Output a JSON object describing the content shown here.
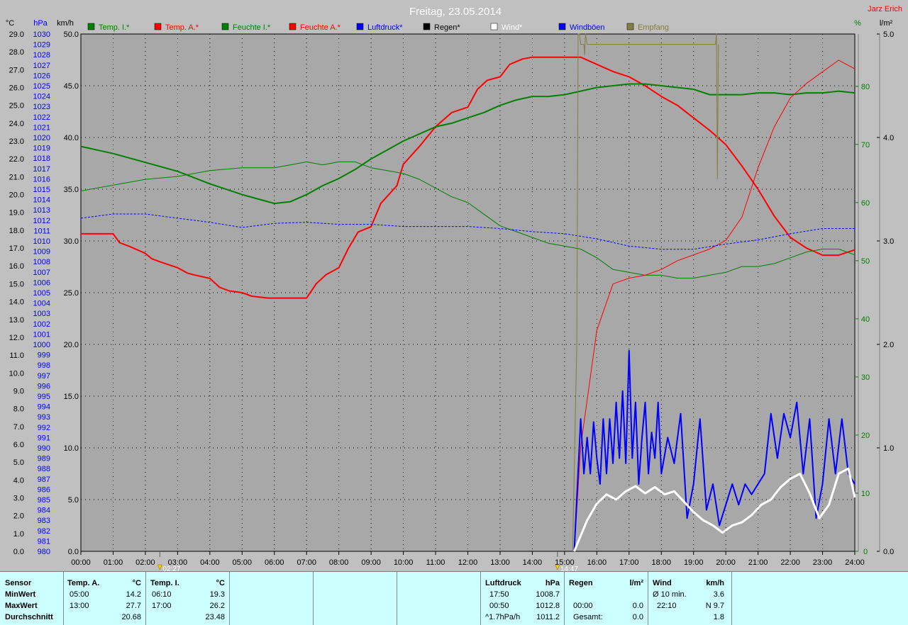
{
  "title": "Freitag, 23.05.2014",
  "author": "Jarz Erich",
  "axis_units": {
    "temp": "°C",
    "pressure": "hPa",
    "wind": "km/h",
    "humidity": "%",
    "rain": "l/m²"
  },
  "legend": [
    {
      "name": "Temp. I.*",
      "color": "#008000"
    },
    {
      "name": "Temp. A.*",
      "color": "#ff0000"
    },
    {
      "name": "Feuchte I.*",
      "color": "#008000"
    },
    {
      "name": "Feuchte A.*",
      "color": "#ff0000"
    },
    {
      "name": "Luftdruck*",
      "color": "#0000ff"
    },
    {
      "name": "Regen*",
      "color": "#000000"
    },
    {
      "name": "Wind*",
      "color": "#ffffff"
    },
    {
      "name": "Windböen",
      "color": "#0000ff"
    },
    {
      "name": "Empfang",
      "color": "#808040"
    }
  ],
  "markers": [
    {
      "label": "02:27",
      "hour": 2.45,
      "color": "#ffd000"
    },
    {
      "label": "14:47",
      "hour": 14.78,
      "color": "#ffd000"
    }
  ],
  "chart_data": {
    "type": "line",
    "x_unit": "hour of day",
    "xlim": [
      0,
      24
    ],
    "x_tick_labels": [
      "00:00",
      "01:00",
      "02:00",
      "03:00",
      "04:00",
      "05:00",
      "06:00",
      "07:00",
      "08:00",
      "09:00",
      "10:00",
      "11:00",
      "12:00",
      "13:00",
      "14:00",
      "15:00",
      "16:00",
      "17:00",
      "18:00",
      "19:00",
      "20:00",
      "21:00",
      "22:00",
      "23:00",
      "24:00"
    ],
    "axes": {
      "temp": {
        "label": "°C",
        "range": [
          0,
          29
        ],
        "step": 1
      },
      "pressure": {
        "label": "hPa",
        "range": [
          980,
          1030
        ],
        "step": 1
      },
      "wind": {
        "label": "km/h",
        "range": [
          0,
          50
        ],
        "step": 5
      },
      "humidity": {
        "label": "%",
        "range": [
          0,
          89
        ],
        "ticks": [
          0,
          10,
          20,
          30,
          40,
          50,
          60,
          70,
          80
        ]
      },
      "rain": {
        "label": "l/m²",
        "range": [
          0,
          5
        ],
        "ticks": [
          0,
          1,
          2,
          3,
          4,
          5
        ]
      }
    },
    "series": [
      {
        "name": "Temp. A.*",
        "axis": "temp",
        "color": "#ff0000",
        "width": 2,
        "x": [
          0,
          1,
          1.2,
          1.5,
          2,
          2.2,
          2.5,
          3,
          3.3,
          3.5,
          4,
          4.3,
          4.6,
          5,
          5.3,
          5.8,
          6,
          6.5,
          7,
          7.3,
          7.6,
          8,
          8.3,
          8.6,
          9,
          9.3,
          9.8,
          10,
          10.5,
          11,
          11.5,
          12,
          12.3,
          12.6,
          13,
          13.3,
          13.7,
          14,
          14.5,
          15,
          15.5,
          16,
          16.5,
          17,
          17.5,
          18,
          18.5,
          19,
          19.5,
          20,
          20.5,
          21,
          21.5,
          22,
          22.5,
          23,
          23.5,
          24
        ],
        "y": [
          17.8,
          17.8,
          17.3,
          17.1,
          16.7,
          16.4,
          16.2,
          15.9,
          15.6,
          15.5,
          15.3,
          14.8,
          14.6,
          14.5,
          14.3,
          14.2,
          14.2,
          14.2,
          14.2,
          15.0,
          15.5,
          15.9,
          17.0,
          17.9,
          18.2,
          19.5,
          20.5,
          21.7,
          22.7,
          23.8,
          24.6,
          24.9,
          25.9,
          26.4,
          26.6,
          27.3,
          27.6,
          27.7,
          27.7,
          27.7,
          27.7,
          27.3,
          26.9,
          26.6,
          26.1,
          25.5,
          25.0,
          24.3,
          23.6,
          22.8,
          21.6,
          20.3,
          18.8,
          17.6,
          17.0,
          16.6,
          16.6,
          16.9
        ]
      },
      {
        "name": "Temp. I.*",
        "axis": "temp",
        "color": "#008000",
        "width": 2,
        "x": [
          0,
          1,
          2,
          3,
          4,
          5,
          6,
          6.5,
          7,
          7.5,
          8,
          8.5,
          9,
          9.5,
          10,
          10.5,
          11,
          11.5,
          12,
          12.5,
          13,
          13.5,
          14,
          14.5,
          15,
          15.5,
          16,
          16.5,
          17,
          17.5,
          18,
          18.5,
          19,
          19.5,
          20,
          20.5,
          21,
          21.5,
          22,
          22.5,
          23,
          23.5,
          24
        ],
        "y": [
          22.7,
          22.3,
          21.8,
          21.3,
          20.6,
          20.0,
          19.5,
          19.6,
          20.0,
          20.5,
          20.9,
          21.4,
          22.0,
          22.5,
          23.0,
          23.4,
          23.8,
          24.0,
          24.3,
          24.6,
          25.0,
          25.3,
          25.5,
          25.5,
          25.6,
          25.8,
          26.0,
          26.1,
          26.2,
          26.2,
          26.1,
          26.0,
          25.9,
          25.6,
          25.6,
          25.6,
          25.7,
          25.7,
          25.6,
          25.7,
          25.7,
          25.8,
          25.7
        ]
      },
      {
        "name": "Feuchte I.*",
        "axis": "humidity",
        "color": "#008000",
        "width": 1,
        "x": [
          0,
          1,
          2,
          3,
          4,
          5,
          6,
          6.5,
          7,
          7.5,
          8,
          8.5,
          9,
          9.5,
          10,
          10.5,
          11,
          11.5,
          12,
          12.5,
          13,
          13.5,
          14,
          14.5,
          15,
          15.5,
          16,
          16.5,
          17,
          17.5,
          18,
          18.5,
          19,
          19.5,
          20,
          20.5,
          21,
          21.5,
          22,
          22.5,
          23,
          23.5,
          24
        ],
        "y": [
          62,
          63,
          64,
          64.5,
          65.5,
          66,
          66,
          66.5,
          67,
          66.5,
          67,
          67,
          66,
          65.5,
          65,
          64,
          62.5,
          61,
          60,
          58,
          56,
          55,
          54,
          53,
          52.5,
          52,
          50.5,
          48.5,
          48,
          47.5,
          47.5,
          47,
          47,
          47.5,
          48,
          49,
          49,
          49.5,
          50.5,
          51.5,
          52,
          52,
          51
        ]
      },
      {
        "name": "Feuchte A.*",
        "axis": "humidity",
        "color": "#ff0000",
        "width": 1,
        "x": [
          15.3,
          15.5,
          16,
          16.5,
          17,
          17.5,
          18,
          18.5,
          19,
          19.5,
          20,
          20.5,
          21,
          21.5,
          22,
          22.5,
          23,
          23.5,
          24
        ],
        "y": [
          0,
          18,
          38,
          46,
          47,
          47.5,
          48.5,
          50,
          51,
          52,
          53.5,
          57.5,
          66,
          73,
          78,
          80.5,
          82.5,
          84.5,
          83
        ]
      },
      {
        "name": "Luftdruck*",
        "axis": "pressure",
        "color": "#0000ff",
        "width": 1,
        "dash": true,
        "x": [
          0,
          1,
          2,
          3,
          4,
          5,
          6,
          7,
          8,
          9,
          10,
          11,
          12,
          13,
          14,
          15,
          16,
          17,
          18,
          19,
          20,
          21,
          22,
          23,
          24
        ],
        "y": [
          1012.2,
          1012.6,
          1012.6,
          1012.2,
          1011.8,
          1011.3,
          1011.7,
          1011.8,
          1011.6,
          1011.6,
          1011.4,
          1011.4,
          1011.4,
          1011.2,
          1010.9,
          1010.7,
          1010.2,
          1009.5,
          1009.2,
          1009.2,
          1009.7,
          1010.1,
          1010.7,
          1011.2,
          1011.2
        ]
      },
      {
        "name": "Windböen",
        "axis": "wind",
        "color": "#0000ff",
        "width": 2,
        "x": [
          15.3,
          15.5,
          15.6,
          15.7,
          15.8,
          15.9,
          16.0,
          16.1,
          16.2,
          16.3,
          16.4,
          16.5,
          16.6,
          16.7,
          16.8,
          16.9,
          17.0,
          17.1,
          17.2,
          17.3,
          17.4,
          17.5,
          17.6,
          17.7,
          17.8,
          17.9,
          18.0,
          18.2,
          18.4,
          18.6,
          18.8,
          19.0,
          19.2,
          19.4,
          19.6,
          19.8,
          20.0,
          20.2,
          20.4,
          20.6,
          20.8,
          21.0,
          21.2,
          21.4,
          21.6,
          21.8,
          22.0,
          22.2,
          22.4,
          22.6,
          22.8,
          23.0,
          23.2,
          23.4,
          23.6,
          23.8,
          24.0
        ],
        "y": [
          0,
          12.8,
          7.5,
          11,
          7.5,
          12.5,
          9,
          6.5,
          12.8,
          7.5,
          12.8,
          8.5,
          14.4,
          9,
          15.5,
          8.5,
          19.4,
          9,
          14.4,
          6.5,
          11,
          14.4,
          7.5,
          11.5,
          9,
          14.4,
          7.5,
          11,
          8.5,
          13.3,
          3.2,
          6.5,
          12.8,
          4,
          6.5,
          2.5,
          4.5,
          6.5,
          4.5,
          6.5,
          5.5,
          6.5,
          7.5,
          13.3,
          9,
          13.3,
          11,
          14.4,
          7.5,
          12.8,
          3.2,
          6.5,
          12.8,
          7.5,
          12.8,
          7.5,
          6.5
        ]
      },
      {
        "name": "Wind*",
        "axis": "wind",
        "color": "#ffffff",
        "width": 3,
        "x": [
          15.3,
          15.5,
          15.7,
          16.0,
          16.3,
          16.6,
          16.9,
          17.2,
          17.5,
          17.8,
          18.1,
          18.4,
          18.7,
          19.0,
          19.3,
          19.6,
          19.9,
          20.2,
          20.5,
          20.8,
          21.1,
          21.4,
          21.7,
          22.0,
          22.3,
          22.6,
          22.9,
          23.2,
          23.5,
          23.8,
          24.0
        ],
        "y": [
          0,
          1.5,
          3.0,
          4.6,
          5.5,
          5.0,
          5.8,
          6.3,
          5.6,
          6.2,
          5.5,
          5.8,
          4.8,
          3.8,
          3.0,
          2.5,
          1.8,
          2.5,
          2.8,
          3.5,
          4.5,
          5.0,
          6.2,
          7.0,
          7.5,
          5.6,
          3.2,
          4.5,
          7.5,
          8.0,
          5.2
        ]
      },
      {
        "name": "Empfang",
        "axis": "wind",
        "color": "#808040",
        "width": 1,
        "x": [
          15.25,
          15.38,
          15.42,
          15.46,
          15.5,
          15.6,
          15.62,
          15.65,
          15.7,
          19.68,
          19.71,
          19.74,
          19.77
        ],
        "y": [
          0,
          20,
          50,
          50,
          49,
          49,
          48,
          50,
          49,
          49,
          50,
          36,
          49
        ]
      }
    ]
  },
  "stats": {
    "sensor": {
      "header": "Sensor",
      "rows": [
        "MinWert",
        "MaxWert",
        "Durchschnitt"
      ]
    },
    "temp_a": {
      "header": "Temp. A.",
      "unit": "°C",
      "times": [
        "05:00",
        "13:00",
        ""
      ],
      "values": [
        "14.2",
        "27.7",
        "20.68"
      ]
    },
    "temp_i": {
      "header": "Temp. I.",
      "unit": "°C",
      "times": [
        "06:10",
        "17:00",
        ""
      ],
      "values": [
        "19.3",
        "26.2",
        "23.48"
      ]
    },
    "pressure": {
      "header": "Luftdruck",
      "unit": "hPa",
      "times": [
        "17:50",
        "00:50",
        "^1.7hPa/h"
      ],
      "values": [
        "1008.7",
        "1012.8",
        "1011.2"
      ]
    },
    "rain": {
      "header": "Regen",
      "unit": "l/m²",
      "times": [
        "",
        "00:00",
        "Gesamt:"
      ],
      "values": [
        "",
        "0.0",
        "0.0"
      ]
    },
    "wind": {
      "header": "Wind",
      "unit": "km/h",
      "times": [
        "Ø 10 min.",
        "22:10",
        ""
      ],
      "values": [
        "3.6",
        "N 9.7",
        "1.8"
      ]
    }
  }
}
